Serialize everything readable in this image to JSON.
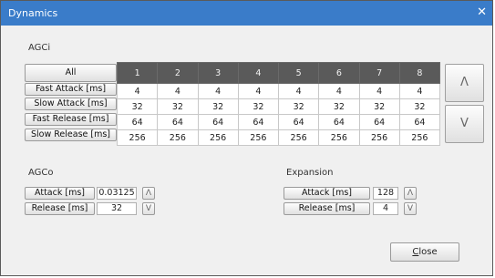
{
  "window": {
    "title": "Dynamics",
    "close_glyph": "✕"
  },
  "agci": {
    "label": "AGCi",
    "all_label": "All",
    "channels": [
      "1",
      "2",
      "3",
      "4",
      "5",
      "6",
      "7",
      "8"
    ],
    "rows": [
      {
        "label": "Fast Attack [ms]",
        "values": [
          "4",
          "4",
          "4",
          "4",
          "4",
          "4",
          "4",
          "4"
        ]
      },
      {
        "label": "Slow Attack [ms]",
        "values": [
          "32",
          "32",
          "32",
          "32",
          "32",
          "32",
          "32",
          "32"
        ]
      },
      {
        "label": "Fast Release [ms]",
        "values": [
          "64",
          "64",
          "64",
          "64",
          "64",
          "64",
          "64",
          "64"
        ]
      },
      {
        "label": "Slow Release [ms]",
        "values": [
          "256",
          "256",
          "256",
          "256",
          "256",
          "256",
          "256",
          "256"
        ]
      }
    ],
    "up_glyph": "Λ",
    "down_glyph": "V"
  },
  "agco": {
    "label": "AGCo",
    "attack_label": "Attack [ms]",
    "attack_value": "0.03125",
    "release_label": "Release [ms]",
    "release_value": "32"
  },
  "expansion": {
    "label": "Expansion",
    "attack_label": "Attack [ms]",
    "attack_value": "128",
    "release_label": "Release [ms]",
    "release_value": "4"
  },
  "small_up_glyph": "Λ",
  "small_down_glyph": "V",
  "footer": {
    "close_first": "C",
    "close_rest": "lose"
  }
}
